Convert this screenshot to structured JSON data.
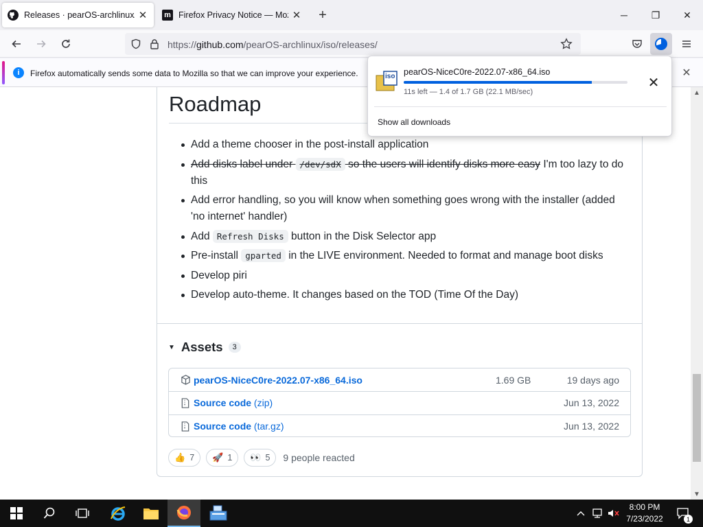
{
  "browser": {
    "tabs": [
      {
        "title": "Releases · pearOS-archlinux/iso",
        "close": "✕"
      },
      {
        "title": "Firefox Privacy Notice — Mozilla",
        "close": "✕"
      }
    ],
    "new_tab": "+",
    "window_controls": {
      "minimize": "─",
      "maximize": "❐",
      "close": "✕"
    },
    "url": {
      "prefix": "https://",
      "domain": "github.com",
      "path": "/pearOS-archlinux/iso/releases/"
    }
  },
  "notification": {
    "icon": "i",
    "message": "Firefox automatically sends some data to Mozilla so that we can improve your experience.",
    "close": "✕"
  },
  "downloads_panel": {
    "file_name": "pearOS-NiceC0re-2022.07-x86_64.iso",
    "file_icon_text": "iso",
    "progress_fraction": 0.84,
    "status": "11s left — 1.4 of 1.7 GB (22.1 MB/sec)",
    "close": "✕",
    "show_all": "Show all downloads"
  },
  "release": {
    "roadmap_title": "Roadmap",
    "roadmap": {
      "item1": "Add a theme chooser in the post-install application",
      "item2_strike_a": "Add disks label under ",
      "item2_code": "/dev/sdX",
      "item2_strike_b": " so the users will identify disks more easy",
      "item2_rest": " I'm too lazy to do this",
      "item3": "Add error handling, so you will know when something goes wrong with the installer (added 'no internet' handler)",
      "item4_a": "Add ",
      "item4_code": "Refresh Disks",
      "item4_b": " button in the Disk Selector app",
      "item5_a": "Pre-install ",
      "item5_code": "gparted",
      "item5_b": " in the LIVE environment. Needed to format and manage boot disks",
      "item6": "Develop piri",
      "item7": "Develop auto-theme. It changes based on the TOD (Time Of the Day)"
    },
    "assets": {
      "toggle": "▼",
      "label": "Assets",
      "count": "3",
      "rows": [
        {
          "name": "pearOS-NiceC0re-2022.07-x86_64.iso",
          "sub": "",
          "size": "1.69 GB",
          "date": "19 days ago"
        },
        {
          "name": "Source code",
          "sub": "(zip)",
          "size": "",
          "date": "Jun 13, 2022"
        },
        {
          "name": "Source code",
          "sub": "(tar.gz)",
          "size": "",
          "date": "Jun 13, 2022"
        }
      ]
    },
    "reactions": {
      "items": [
        {
          "emoji": "👍",
          "count": "7"
        },
        {
          "emoji": "🚀",
          "count": "1"
        },
        {
          "emoji": "👀",
          "count": "5"
        }
      ],
      "summary": "9 people reacted"
    }
  },
  "taskbar": {
    "time": "8:00 PM",
    "date": "7/23/2022",
    "notification_count": "1"
  },
  "colors": {
    "accent": "#0969da",
    "progress": "#0060df",
    "taskbar": "#101010"
  }
}
